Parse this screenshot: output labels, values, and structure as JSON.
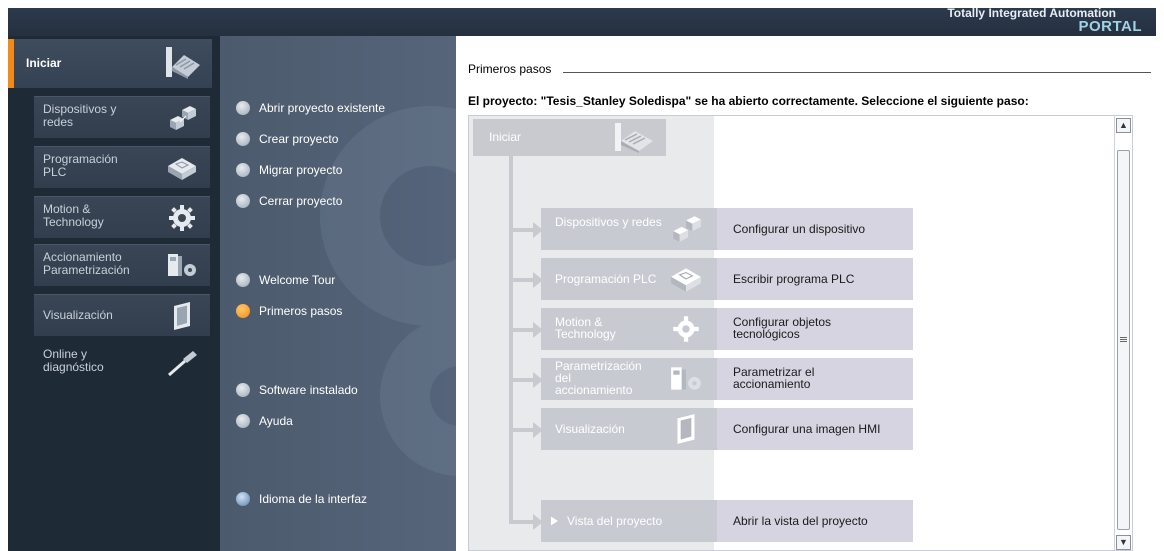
{
  "header": {
    "brand_line1": "Totally Integrated Automation",
    "brand_line2": "PORTAL"
  },
  "leftnav": {
    "main": {
      "label": "Iniciar",
      "icon": "factory-icon"
    },
    "items": [
      {
        "label": "Dispositivos y redes",
        "icon": "devices-icon"
      },
      {
        "label": "Programación PLC",
        "icon": "plc-icon"
      },
      {
        "label": "Motion & Technology",
        "icon": "gear-icon"
      },
      {
        "label": "Accionamiento Parametrización",
        "icon": "drive-icon"
      },
      {
        "label": "Visualización",
        "icon": "hmi-icon"
      },
      {
        "label": "Online y diagnóstico",
        "icon": "probe-icon"
      }
    ]
  },
  "midpanel": {
    "items": [
      {
        "label": "Abrir proyecto existente"
      },
      {
        "label": "Crear proyecto"
      },
      {
        "label": "Migrar proyecto"
      },
      {
        "label": "Cerrar proyecto"
      },
      {
        "label": "Welcome Tour"
      },
      {
        "label": "Primeros pasos",
        "active": true
      },
      {
        "label": "Software instalado"
      },
      {
        "label": "Ayuda"
      },
      {
        "label": "Idioma de la interfaz"
      }
    ]
  },
  "rightpanel": {
    "title": "Primeros pasos",
    "message": "El proyecto: \"Tesis_Stanley Soledispa\" se ha abierto correctamente. Seleccione el siguiente paso:",
    "start_label": "Iniciar",
    "steps": [
      {
        "label": "Dispositivos y redes",
        "action": "Configurar un dispositivo",
        "icon": "devices-icon"
      },
      {
        "label": "Programación PLC",
        "action": "Escribir programa PLC",
        "icon": "plc-icon"
      },
      {
        "label": "Motion & Technology",
        "action": "Configurar objetos tecnológicos",
        "icon": "gear-icon"
      },
      {
        "label": "Parametrización del accionamiento",
        "action": "Parametrizar el accionamiento",
        "icon": "drive-icon"
      },
      {
        "label": "Visualización",
        "action": "Configurar una imagen HMI",
        "icon": "hmi-icon"
      },
      {
        "label": "Vista del proyecto",
        "action": "Abrir la vista del proyecto",
        "icon": "play-icon"
      }
    ]
  },
  "colors": {
    "accent": "#f08a18",
    "nav_bg": "#1f2a37",
    "mid_bg": "#52617a"
  }
}
